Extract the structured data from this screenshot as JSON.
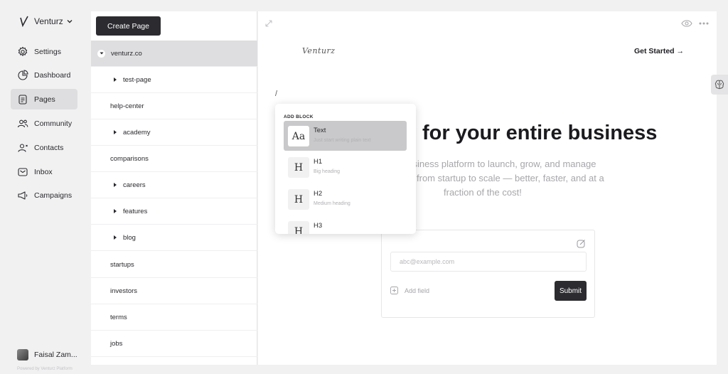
{
  "workspace": {
    "name": "Venturz"
  },
  "nav": {
    "items": [
      {
        "label": "Settings",
        "icon": "gear-icon"
      },
      {
        "label": "Dashboard",
        "icon": "pie-chart-icon"
      },
      {
        "label": "Pages",
        "icon": "document-icon",
        "active": true
      },
      {
        "label": "Community",
        "icon": "users-icon"
      },
      {
        "label": "Contacts",
        "icon": "contact-icon"
      },
      {
        "label": "Inbox",
        "icon": "mail-icon"
      },
      {
        "label": "Campaigns",
        "icon": "megaphone-icon"
      }
    ]
  },
  "user": {
    "name": "Faisal Zam..."
  },
  "footer": {
    "powered": "Powered by Venturz Platform"
  },
  "pages_panel": {
    "create_label": "Create Page",
    "pages": [
      {
        "label": "venturz.co",
        "level": 0,
        "expanded": true,
        "selected": true
      },
      {
        "label": "test-page",
        "level": 1,
        "has_children": true
      },
      {
        "label": "help-center",
        "level": 0
      },
      {
        "label": "academy",
        "level": 1,
        "has_children": true
      },
      {
        "label": "comparisons",
        "level": 0
      },
      {
        "label": "careers",
        "level": 1,
        "has_children": true
      },
      {
        "label": "features",
        "level": 1,
        "has_children": true
      },
      {
        "label": "blog",
        "level": 1,
        "has_children": true
      },
      {
        "label": "startups",
        "level": 0
      },
      {
        "label": "investors",
        "level": 0
      },
      {
        "label": "terms",
        "level": 0
      },
      {
        "label": "jobs",
        "level": 0
      }
    ]
  },
  "preview": {
    "brand": "Venturz",
    "cta": "Get Started →",
    "hero_title": "for your entire business",
    "hero_sub_1": "business platform to launch, grow, and manage",
    "hero_sub_2": "from startup to scale — better, faster, and at a",
    "hero_sub_3": "fraction of the cost!",
    "form": {
      "email_placeholder": "abc@example.com",
      "add_field_label": "Add field",
      "submit_label": "Submit"
    }
  },
  "add_block": {
    "title": "ADD BLOCK",
    "options": [
      {
        "icon_text": "Aa",
        "name": "Text",
        "desc": "Just start writing plain text"
      },
      {
        "icon_text": "H",
        "name": "H1",
        "desc": "Big heading"
      },
      {
        "icon_text": "H",
        "name": "H2",
        "desc": "Medium heading"
      },
      {
        "icon_text": "H",
        "name": "H3",
        "desc": ""
      }
    ]
  },
  "colors": {
    "dark_button": "#2b2b30",
    "active_bg": "#dedee0",
    "highlight_bg": "#c9c9cb"
  }
}
